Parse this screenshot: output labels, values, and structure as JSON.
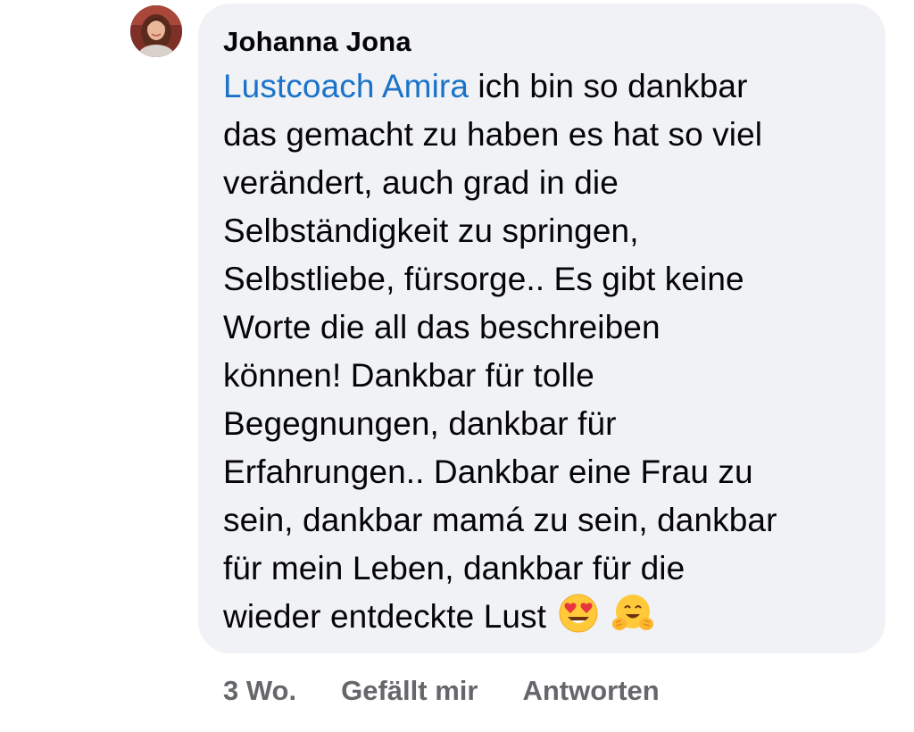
{
  "comment": {
    "author": "Johanna Jona",
    "mention": "Lustcoach Amira",
    "lines": [
      " ich bin so dankbar",
      "das gemacht zu haben es hat so viel",
      "verändert, auch grad in die",
      "Selbständigkeit zu springen,",
      "Selbstliebe, fürsorge.. Es gibt keine",
      "Worte die all das beschreiben",
      "können! Dankbar für tolle",
      "Begegnungen, dankbar für",
      "Erfahrungen.. Dankbar eine Frau zu",
      "sein, dankbar mamá zu sein, dankbar",
      "für mein Leben, dankbar für die",
      "wieder entdeckte Lust"
    ],
    "emojis": [
      "heart-eyes-emoji",
      "hugging-face-emoji"
    ],
    "avatar_icon": "profile-photo",
    "colors": {
      "bubble": "#f0f2f5",
      "mention": "#1a73c9",
      "meta": "#65676b"
    }
  },
  "actions": {
    "time": "3 Wo.",
    "like_label": "Gefällt mir",
    "reply_label": "Antworten"
  }
}
